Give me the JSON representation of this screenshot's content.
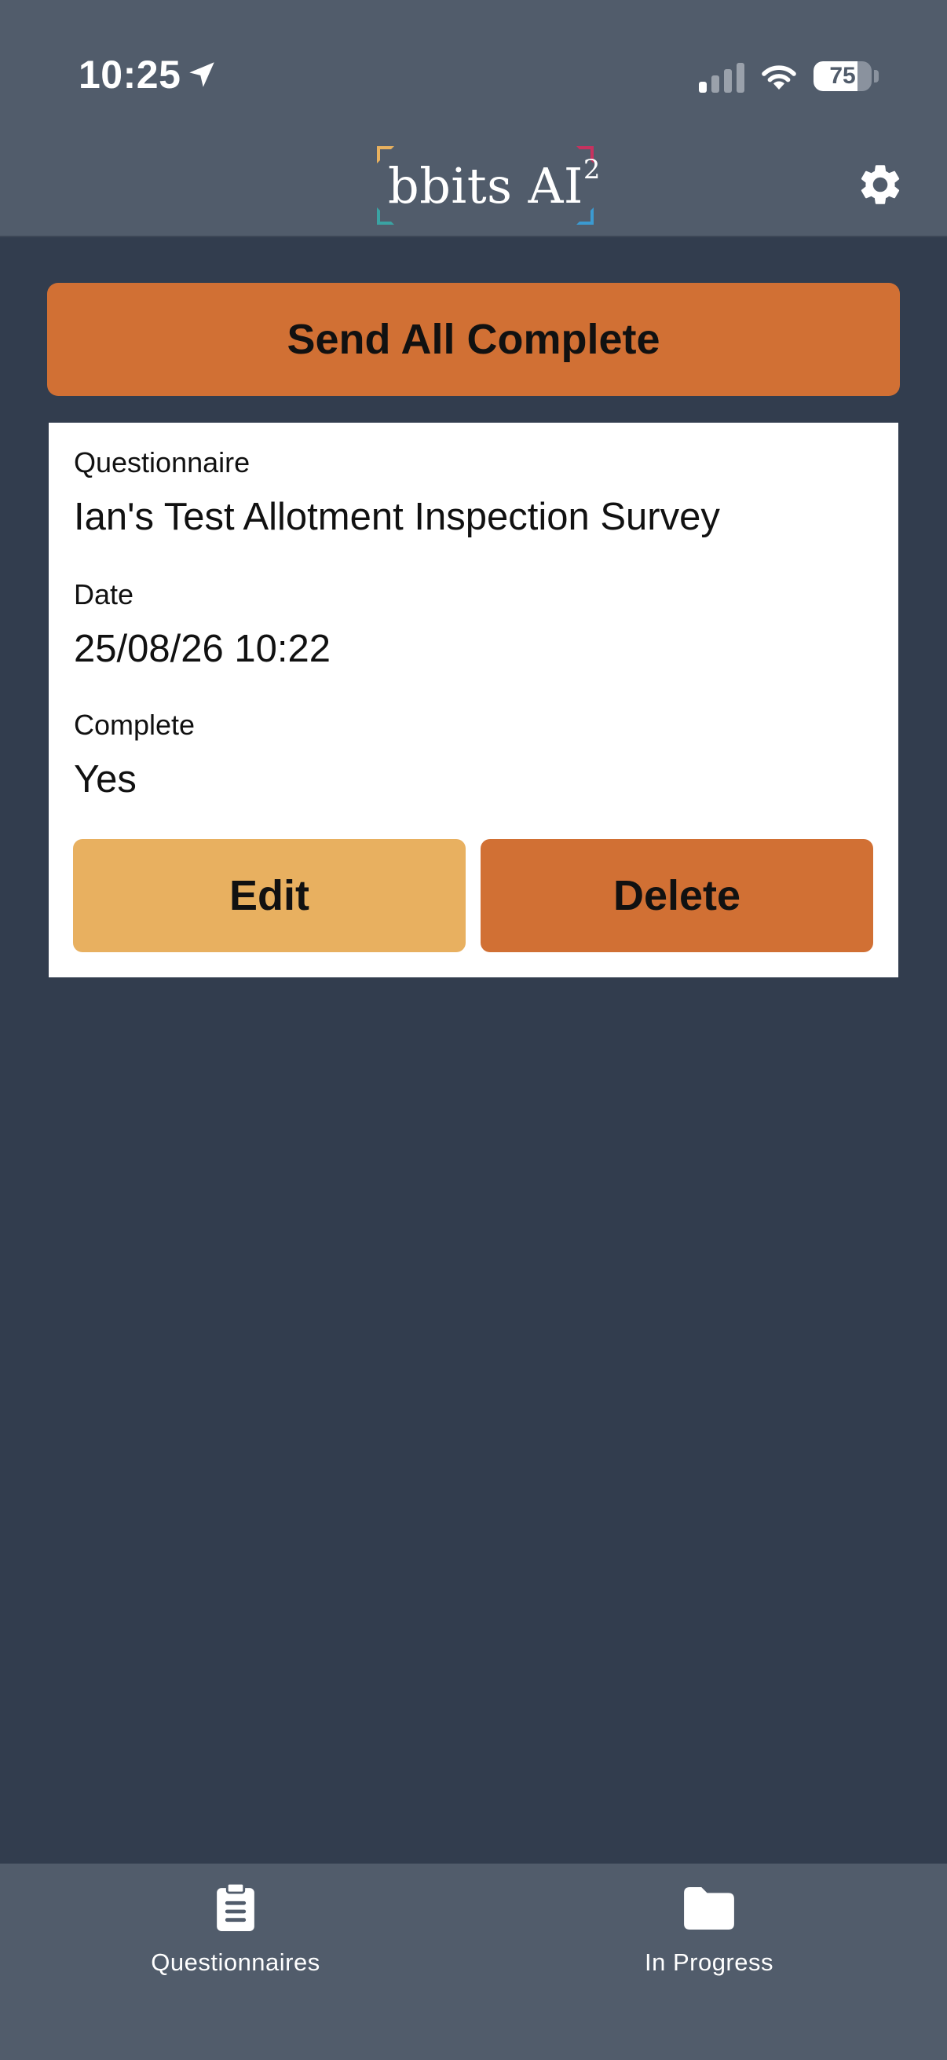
{
  "status_bar": {
    "time": "10:25",
    "battery_percent": "75",
    "battery_level": 0.75
  },
  "header": {
    "logo_text": "bbits AI",
    "logo_superscript": "2",
    "settings_icon": "gear-icon"
  },
  "actions": {
    "send_all_label": "Send All Complete"
  },
  "record": {
    "questionnaire_label": "Questionnaire",
    "questionnaire_value": "Ian's Test Allotment Inspection Survey",
    "date_label": "Date",
    "date_value": "25/08/26 10:22",
    "complete_label": "Complete",
    "complete_value": "Yes",
    "edit_label": "Edit",
    "delete_label": "Delete"
  },
  "tabbar": {
    "items": [
      {
        "label": "Questionnaires",
        "icon": "clipboard-icon"
      },
      {
        "label": "In Progress",
        "icon": "folder-icon"
      }
    ]
  },
  "colors": {
    "background": "#323d4e",
    "header": "#515c6b",
    "accent_orange": "#d17034",
    "accent_amber": "#e8b060"
  }
}
